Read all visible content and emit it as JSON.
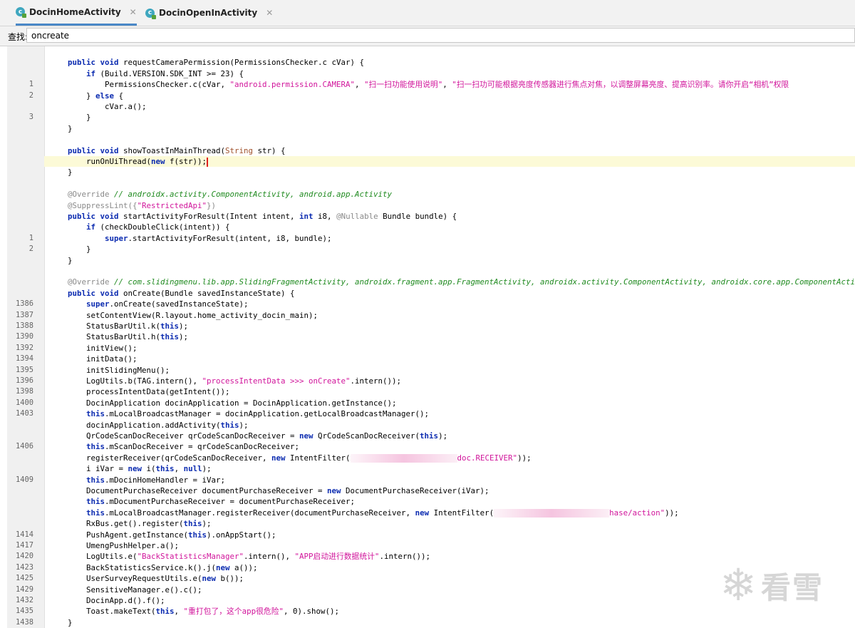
{
  "tabs": [
    {
      "label": "DocinHomeActivity",
      "icon": "c",
      "active": true
    },
    {
      "label": "DocinOpenInActivity",
      "icon": "c",
      "active": false
    }
  ],
  "find": {
    "label": "查找:",
    "value": "oncreate"
  },
  "code": {
    "l0": {
      "lno": "",
      "text": ""
    },
    "l1": {
      "lno": "",
      "a": "public void ",
      "b": "requestCameraPermission(PermissionsChecker.c cVar) {"
    },
    "l2": {
      "lno": "1",
      "a": "    if ",
      "b": "(Build.VERSION.SDK_INT >= 23) {"
    },
    "l3": {
      "lno": "2",
      "a": "        PermissionsChecker.c(cVar, ",
      "s1": "\"android.permission.CAMERA\"",
      "c": ", ",
      "s2": "\"扫一扫功能使用说明\"",
      "d": ", ",
      "s3": "\"扫一扫功可能根据亮度传感器进行焦点对焦，以调整屏幕亮度、提高识别率。请你开启“相机”权限"
    },
    "l4": {
      "lno": "",
      "a": "    } ",
      "kw": "else",
      "b": " {"
    },
    "l5": {
      "lno": "3",
      "a": "        cVar.a();"
    },
    "l6": {
      "lno": "",
      "a": "    }"
    },
    "l7": {
      "lno": "",
      "a": "}"
    },
    "l8": {
      "lno": "",
      "a": ""
    },
    "l9": {
      "lno": "",
      "kw": "public void ",
      "b": "showToastInMainThread(",
      "t": "String",
      "c": " str) {"
    },
    "l10": {
      "lno": "",
      "a": "    runOnUiThread(",
      "kw": "new",
      "b": " f(str));"
    },
    "l11": {
      "lno": "",
      "a": "}"
    },
    "l12": {
      "lno": "",
      "a": ""
    },
    "l13": {
      "lno": "",
      "ann": "@Override",
      "cmt": " // androidx.activity.ComponentActivity, android.app.Activity"
    },
    "l14": {
      "lno": "",
      "ann": "@SuppressLint({",
      "str": "\"RestrictedApi\"",
      "ann2": "})"
    },
    "l15": {
      "lno": "",
      "kw": "public void ",
      "b": "startActivityForResult(Intent intent, ",
      "kw2": "int",
      "c": " i8, ",
      "ann": "@Nullable",
      "d": " Bundle bundle) {"
    },
    "l16": {
      "lno": "1",
      "a": "    ",
      "kw": "if",
      "b": " (checkDoubleClick(intent)) {"
    },
    "l17": {
      "lno": "2",
      "a": "        ",
      "kw": "super",
      "b": ".startActivityForResult(intent, i8, bundle);"
    },
    "l18": {
      "lno": "",
      "a": "    }"
    },
    "l19": {
      "lno": "",
      "a": "}"
    },
    "l20": {
      "lno": "",
      "a": ""
    },
    "l21": {
      "lno": "",
      "ann": "@Override",
      "cmt": " // com.slidingmenu.lib.app.SlidingFragmentActivity, androidx.fragment.app.FragmentActivity, androidx.activity.ComponentActivity, androidx.core.app.ComponentActivity"
    },
    "l22": {
      "lno": "1386",
      "kw": "public void ",
      "b": "onCreate(Bundle savedInstanceState) {"
    },
    "l23": {
      "lno": "1387",
      "a": "    ",
      "kw": "super",
      "b": ".onCreate(savedInstanceState);"
    },
    "l24": {
      "lno": "1388",
      "a": "    setContentView(R.layout.home_activity_docin_main);"
    },
    "l25": {
      "lno": "1390",
      "a": "    StatusBarUtil.k(",
      "kw": "this",
      "b": ");"
    },
    "l26": {
      "lno": "1392",
      "a": "    StatusBarUtil.h(",
      "kw": "this",
      "b": ");"
    },
    "l27": {
      "lno": "1394",
      "a": "    initView();"
    },
    "l28": {
      "lno": "1395",
      "a": "    initData();"
    },
    "l29": {
      "lno": "1396",
      "a": "    initSlidingMenu();"
    },
    "l30": {
      "lno": "1398",
      "a": "    LogUtils.b(TAG.intern(), ",
      "str": "\"processIntentData >>> onCreate\"",
      "b": ".intern());"
    },
    "l31": {
      "lno": "1400",
      "a": "    processIntentData(getIntent());"
    },
    "l32": {
      "lno": "1403",
      "a": "    DocinApplication docinApplication = DocinApplication.getInstance();"
    },
    "l33": {
      "lno": "",
      "a": "    ",
      "kw": "this",
      "b": ".mLocalBroadcastManager = docinApplication.getLocalBroadcastManager();"
    },
    "l34": {
      "lno": "",
      "a": "    docinApplication.addActivity(",
      "kw": "this",
      "b": ");"
    },
    "l35": {
      "lno": "1406",
      "a": "    QrCodeScanDocReceiver qrCodeScanDocReceiver = ",
      "kw": "new",
      "b": " QrCodeScanDocReceiver(",
      "kw2": "this",
      "c": ");"
    },
    "l36": {
      "lno": "",
      "a": "    ",
      "kw": "this",
      "b": ".mScanDocReceiver = qrCodeScanDocReceiver;"
    },
    "l37": {
      "lno": "",
      "a": "    registerReceiver(qrCodeScanDocReceiver, ",
      "kw": "new",
      "b": " IntentFilter(",
      "str": "doc.RECEIVER\"",
      "c": "));"
    },
    "l38": {
      "lno": "1409",
      "a": "    i iVar = ",
      "kw": "new",
      "b": " i(",
      "kw2": "this",
      "c": ", ",
      "kw3": "null",
      "d": ");"
    },
    "l39": {
      "lno": "",
      "a": "    ",
      "kw": "this",
      "b": ".mDocinHomeHandler = iVar;"
    },
    "l40": {
      "lno": "",
      "a": "    DocumentPurchaseReceiver documentPurchaseReceiver = ",
      "kw": "new",
      "b": " DocumentPurchaseReceiver(iVar);"
    },
    "l41": {
      "lno": "",
      "a": "    ",
      "kw": "this",
      "b": ".mDocumentPurchaseReceiver = documentPurchaseReceiver;"
    },
    "l42": {
      "lno": "",
      "a": "    ",
      "kw": "this",
      "b": ".mLocalBroadcastManager.registerReceiver(documentPurchaseReceiver, ",
      "kw2": "new",
      "c": " IntentFilter(",
      "str": "hase/action\"",
      "d": "));"
    },
    "l43": {
      "lno": "1414",
      "a": "    RxBus.get().register(",
      "kw": "this",
      "b": ");"
    },
    "l44": {
      "lno": "1417",
      "a": "    PushAgent.getInstance(",
      "kw": "this",
      "b": ").onAppStart();"
    },
    "l45": {
      "lno": "1420",
      "a": "    UmengPushHelper.a();"
    },
    "l46": {
      "lno": "1423",
      "a": "    LogUtils.e(",
      "str": "\"BackStatisticsManager\"",
      "b": ".intern(), ",
      "str2": "\"APP启动进行数据统计\"",
      "c": ".intern());"
    },
    "l47": {
      "lno": "1425",
      "a": "    BackStatisticsService.k().j(",
      "kw": "new",
      "b": " a());"
    },
    "l48": {
      "lno": "1429",
      "a": "    UserSurveyRequestUtils.e(",
      "kw": "new",
      "b": " b());"
    },
    "l49": {
      "lno": "1432",
      "a": "    SensitiveManager.e().c();"
    },
    "l50": {
      "lno": "1435",
      "a": "    DocinApp.d().f();"
    },
    "l51": {
      "lno": "1438",
      "a": "    Toast.makeText(",
      "kw": "this",
      "b": ", ",
      "str": "\"重打包了，这个app很危险\"",
      "c": ", 0).show();"
    },
    "l52": {
      "lno": "",
      "a": "}"
    }
  },
  "watermark": {
    "text": "看雪",
    "icon": "snowflake-icon"
  },
  "colors": {
    "keyword": "#0b2bb0",
    "string": "#d1159b",
    "comment": "#1f8a1f",
    "annotation": "#8a8a8a",
    "current_line": "#fcfad7",
    "tab_underline": "#4a88c7"
  }
}
